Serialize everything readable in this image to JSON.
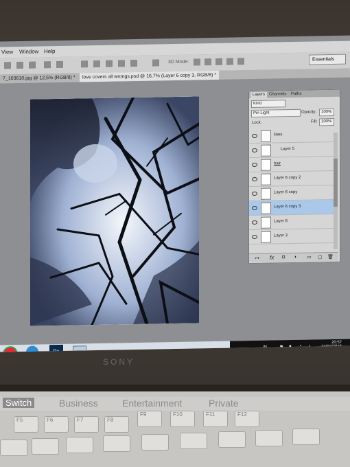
{
  "menubar": {
    "items": [
      "View",
      "Window",
      "Help"
    ]
  },
  "options": {
    "mode_label": "3D Mode:",
    "workspace": "Essentials"
  },
  "tabs": [
    {
      "label": "7_103610.jpg @ 12,5% (RGB/8) *",
      "active": false
    },
    {
      "label": "love covers all wrongs.psd @ 16,7% (Layer 6 copy 3, RGB/8) *",
      "active": true
    }
  ],
  "layers_panel": {
    "tabs": [
      "Layers",
      "Channels",
      "Paths"
    ],
    "filter": "Kind",
    "blend_mode": "Pin Light",
    "opacity_label": "Opacity:",
    "opacity": "100%",
    "lock_label": "Lock:",
    "fill_label": "Fill:",
    "fill": "100%",
    "layers": [
      {
        "name": "lines",
        "selected": false
      },
      {
        "name": "Layer 5",
        "selected": false
      },
      {
        "name": "hair",
        "selected": false
      },
      {
        "name": "Layer 6 copy 2",
        "selected": false
      },
      {
        "name": "Layer 6 copy",
        "selected": false
      },
      {
        "name": "Layer 6 copy 3",
        "selected": true
      },
      {
        "name": "Layer 6",
        "selected": false
      },
      {
        "name": "Layer 3",
        "selected": false
      }
    ]
  },
  "taskbar": {
    "lang": "IN",
    "time": "20:57",
    "date": "22/02/2016",
    "ps_label": "Ps"
  },
  "hardware": {
    "brand": "SONY",
    "switch": "Switch",
    "modes": [
      "Business",
      "Entertainment",
      "Private"
    ],
    "keys": [
      "F5",
      "F6",
      "F7",
      "F8",
      "F9",
      "F10",
      "F11",
      "F12"
    ]
  }
}
